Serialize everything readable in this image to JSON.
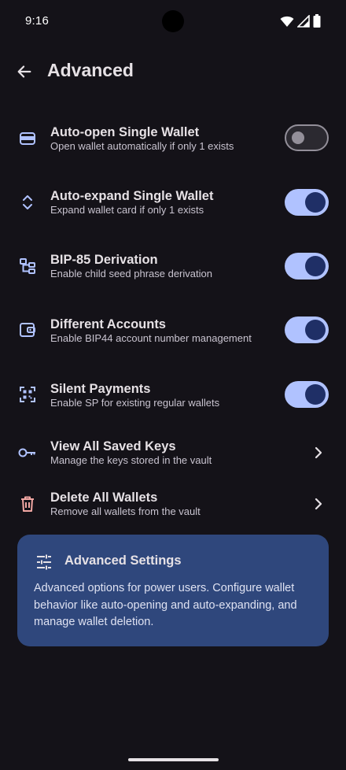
{
  "status_bar": {
    "time": "9:16"
  },
  "header": {
    "title": "Advanced"
  },
  "settings": [
    {
      "title": "Auto-open Single Wallet",
      "subtitle": "Open wallet automatically if only 1 exists",
      "icon": "wallet-card-icon",
      "control": "switch",
      "enabled": false
    },
    {
      "title": "Auto-expand Single Wallet",
      "subtitle": "Expand wallet card if only 1 exists",
      "icon": "expand-chevrons-icon",
      "control": "switch",
      "enabled": true
    },
    {
      "title": "BIP-85 Derivation",
      "subtitle": "Enable child seed phrase derivation",
      "icon": "tree-derivation-icon",
      "control": "switch",
      "enabled": true
    },
    {
      "title": "Different Accounts",
      "subtitle": "Enable BIP44 account number management",
      "icon": "wallet-icon",
      "control": "switch",
      "enabled": true
    },
    {
      "title": "Silent Payments",
      "subtitle": "Enable SP for existing regular wallets",
      "icon": "qr-code-icon",
      "control": "switch",
      "enabled": true
    },
    {
      "title": "View All Saved Keys",
      "subtitle": "Manage the keys stored in the vault",
      "icon": "key-icon",
      "control": "chevron"
    },
    {
      "title": "Delete All Wallets",
      "subtitle": "Remove all wallets from the vault",
      "icon": "trash-icon",
      "control": "chevron"
    }
  ],
  "info_card": {
    "icon": "sliders-icon",
    "title": "Advanced Settings",
    "body": "Advanced options for power users. Configure wallet behavior like auto-opening and auto-expanding, and manage wallet deletion."
  },
  "colors": {
    "background": "#141218",
    "switch_on_track": "#b0c2ff",
    "switch_on_thumb": "#1f2f66",
    "icon_accent": "#b0c2ff",
    "danger_icon": "#f2a7a3",
    "info_card": "#2f477c"
  }
}
